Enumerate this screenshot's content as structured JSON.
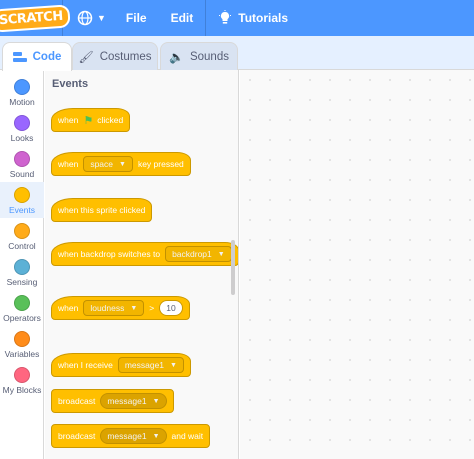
{
  "menubar": {
    "logo": "SCRATCH",
    "file_label": "File",
    "edit_label": "Edit",
    "tutorials_label": "Tutorials",
    "globe_icon": "globe-icon",
    "chevron_icon": "chevron-down-icon",
    "bulb_icon": "lightbulb-icon",
    "bg_color": "#4c97ff"
  },
  "tabs": {
    "code": "Code",
    "costumes": "Costumes",
    "sounds": "Sounds"
  },
  "categories": [
    {
      "label": "Motion",
      "color": "#4c97ff"
    },
    {
      "label": "Looks",
      "color": "#9966ff"
    },
    {
      "label": "Sound",
      "color": "#cf63cf"
    },
    {
      "label": "Events",
      "color": "#ffbf00"
    },
    {
      "label": "Control",
      "color": "#ffab19"
    },
    {
      "label": "Sensing",
      "color": "#5cb1d6"
    },
    {
      "label": "Operators",
      "color": "#59c059"
    },
    {
      "label": "Variables",
      "color": "#ff8c1a"
    },
    {
      "label": "My Blocks",
      "color": "#ff6680"
    }
  ],
  "flyout": {
    "title": "Events",
    "blocks": {
      "flag_clicked": {
        "prefix": "when",
        "suffix": "clicked"
      },
      "key_pressed": {
        "prefix": "when",
        "key": "space",
        "suffix": "key pressed"
      },
      "sprite_clicked": {
        "text": "when this sprite clicked"
      },
      "backdrop_switches": {
        "prefix": "when backdrop switches to",
        "backdrop": "backdrop1"
      },
      "greater_than": {
        "prefix": "when",
        "sensor": "loudness",
        "op": ">",
        "value": "10"
      },
      "receive": {
        "prefix": "when I receive",
        "message": "message1"
      },
      "broadcast": {
        "prefix": "broadcast",
        "message": "message1"
      },
      "broadcast_wait": {
        "prefix": "broadcast",
        "message": "message1",
        "suffix": "and wait"
      }
    }
  }
}
